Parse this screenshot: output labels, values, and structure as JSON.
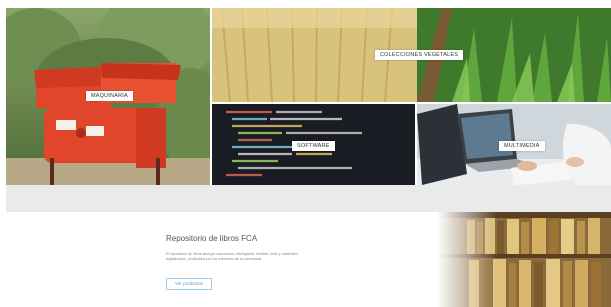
{
  "tiles": {
    "maquinaria": {
      "label": "MAQUINARIA"
    },
    "vegetales": {
      "label": "COLECCIONES VEGETALES"
    },
    "software": {
      "label": "SOFTWARE"
    },
    "multimedia": {
      "label": "MULTIMEDIA"
    }
  },
  "repository": {
    "title": "Repositorio de libros FCA",
    "description": "El repositorio de libros alberga colecciones, bibliografía, revistas, tesis y materiales digitalizados, producidos por los miembros de la comunidad.",
    "button_label": "Ver productos"
  },
  "colors": {
    "band_gray": "#eaeaea",
    "button_border": "#9fc9e6",
    "button_text": "#5a9bcd",
    "machine_red": "#e2462a"
  }
}
